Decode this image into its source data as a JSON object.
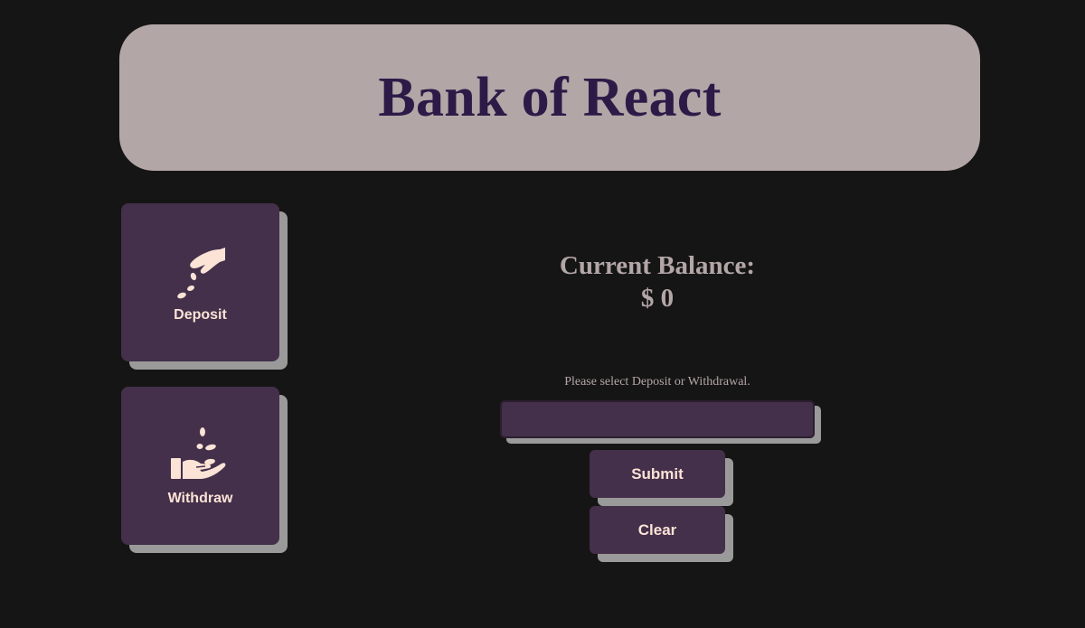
{
  "header": {
    "title": "Bank of React"
  },
  "actions": {
    "deposit": {
      "label": "Deposit",
      "icon": "hand-dropping-coins-icon"
    },
    "withdraw": {
      "label": "Withdraw",
      "icon": "hand-receiving-coins-icon"
    }
  },
  "balance": {
    "heading": "Current Balance:",
    "value": "$ 0"
  },
  "form": {
    "hint": "Please select Deposit or Withdrawal.",
    "amount_value": "",
    "submit_label": "Submit",
    "clear_label": "Clear"
  },
  "colors": {
    "background": "#161515",
    "header_bg": "#b3a6a7",
    "title_text": "#2e1a47",
    "card_bg": "#44304a",
    "button_text": "#fbe3d6",
    "shadow": "#9a9a9a"
  }
}
